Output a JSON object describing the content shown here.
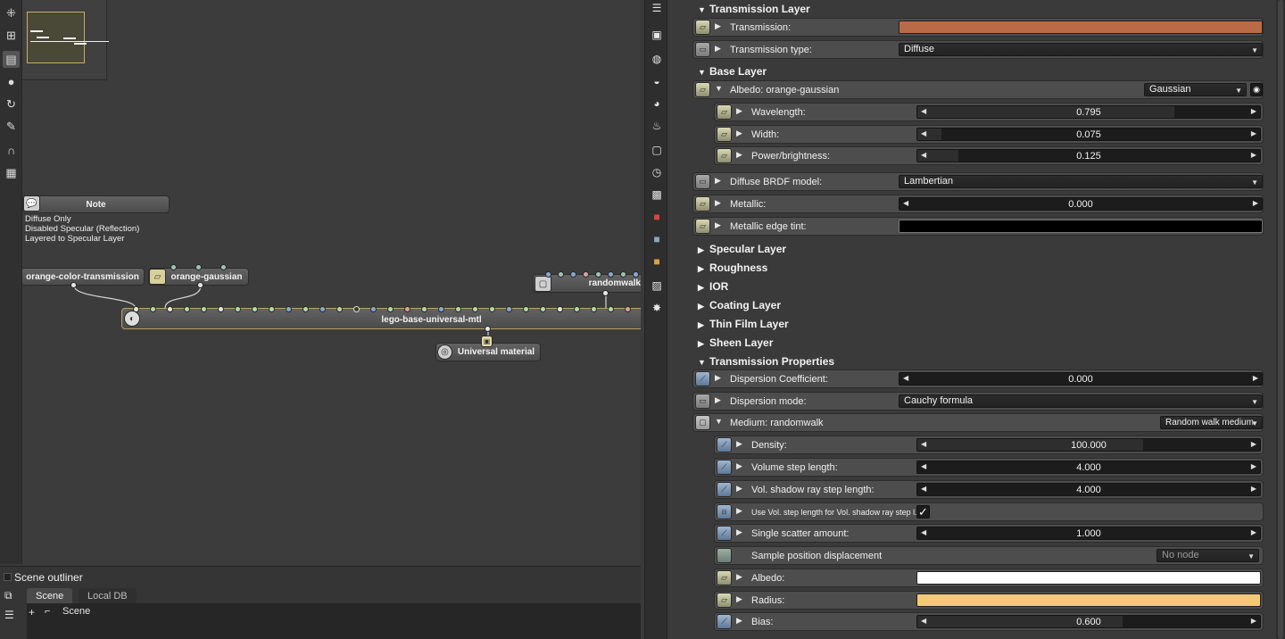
{
  "left_toolbar": {
    "icons": [
      "graph-select-icon",
      "graph-nodes-icon",
      "graph-editor-icon",
      "material-icon",
      "refresh-icon",
      "paint-icon",
      "magnet-icon",
      "grid-icon"
    ]
  },
  "graph": {
    "note": {
      "title": "Note",
      "lines": [
        "Diffuse Only",
        "Disabled Specular (Reflection)",
        "Layered to Specular Layer"
      ]
    },
    "nodes": {
      "orange_color_transmission": "orange-color-transmission",
      "orange_gaussian": "orange-gaussian",
      "randomwalk": "randomwalk",
      "lego_base": "lego-base-universal-mtl",
      "universal_material": "Universal material"
    }
  },
  "outliner": {
    "title": "Scene outliner",
    "tabs": [
      "Scene",
      "Local DB"
    ],
    "tree": {
      "expand": "+",
      "item": "Scene"
    }
  },
  "inspector": {
    "sections": {
      "transmission_layer": "Transmission Layer",
      "base_layer": "Base Layer",
      "specular_layer": "Specular Layer",
      "roughness": "Roughness",
      "ior": "IOR",
      "coating_layer": "Coating Layer",
      "thin_film_layer": "Thin Film Layer",
      "sheen_layer": "Sheen Layer",
      "transmission_properties": "Transmission Properties"
    },
    "rows": {
      "transmission": {
        "label": "Transmission:",
        "color": "#b96a47"
      },
      "transmission_type": {
        "label": "Transmission type:",
        "value": "Diffuse"
      },
      "albedo_gauss": {
        "label": "Albedo: orange-gaussian",
        "value": "Gaussian"
      },
      "wavelength": {
        "label": "Wavelength:",
        "value": "0.795",
        "fill": 0.75
      },
      "width": {
        "label": "Width:",
        "value": "0.075",
        "fill": 0.07
      },
      "power": {
        "label": "Power/brightness:",
        "value": "0.125",
        "fill": 0.12
      },
      "diffuse_brdf": {
        "label": "Diffuse BRDF model:",
        "value": "Lambertian"
      },
      "metallic": {
        "label": "Metallic:",
        "value": "0.000",
        "fill": 0.0
      },
      "metallic_edge_tint": {
        "label": "Metallic edge tint:",
        "color": "#000000"
      },
      "dispersion_coef": {
        "label": "Dispersion Coefficient:",
        "value": "0.000",
        "fill": 0.0
      },
      "dispersion_mode": {
        "label": "Dispersion mode:",
        "value": "Cauchy formula"
      },
      "medium": {
        "label": "Medium: randomwalk",
        "value": "Random walk medium"
      },
      "density": {
        "label": "Density:",
        "value": "100.000",
        "fill": 0.66
      },
      "vol_step": {
        "label": "Volume step length:",
        "value": "4.000",
        "fill": 0.0
      },
      "vol_shadow_step": {
        "label": "Vol. shadow ray step length:",
        "value": "4.000",
        "fill": 0.0
      },
      "use_vol_step": {
        "label": "Use Vol. step length for Vol. shadow ray step l...",
        "checked": "✓"
      },
      "single_scatter": {
        "label": "Single scatter amount:",
        "value": "1.000",
        "fill": 0.0
      },
      "sample_pos": {
        "label": "Sample position displacement",
        "value": "No node"
      },
      "albedo": {
        "label": "Albedo:",
        "color": "#ffffff"
      },
      "radius": {
        "label": "Radius:",
        "color": "#f5c97a"
      },
      "bias": {
        "label": "Bias:",
        "value": "0.600",
        "fill": 0.6
      }
    }
  }
}
